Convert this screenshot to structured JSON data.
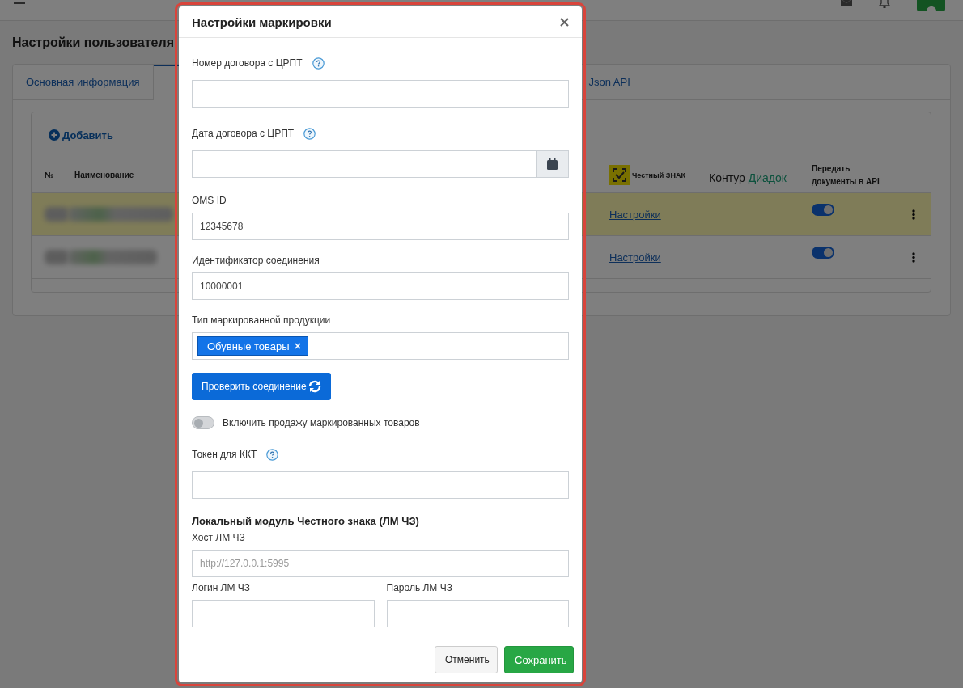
{
  "page": {
    "title": "Настройки пользователя"
  },
  "tabs": [
    {
      "label": "Основная информация",
      "selected": false
    },
    {
      "selected": true
    },
    {
      "label": "Json API",
      "selected": false
    }
  ],
  "card": {
    "add_button": "Добавить"
  },
  "table": {
    "columns": [
      {
        "kind": "text",
        "label": "№"
      },
      {
        "kind": "text",
        "label": "Наименование"
      },
      {
        "kind": "chestny",
        "label": "Честный ЗНАК"
      },
      {
        "kind": "diadok",
        "label": "Контур",
        "accent": "Диадок"
      },
      {
        "kind": "text",
        "label": "Передать документы в API"
      }
    ],
    "rows": [
      {
        "highlighted": true,
        "link": "Настройки",
        "api_on": true
      },
      {
        "highlighted": false,
        "link": "Настройки",
        "api_on": true
      }
    ]
  },
  "modal": {
    "title": "Настройки маркировки",
    "fields": [
      {
        "kind": "text",
        "label": "Номер договора с ЦРПТ",
        "help": true
      },
      {
        "kind": "date",
        "label": "Дата договора с ЦРПТ",
        "help": true
      },
      {
        "kind": "text",
        "label": "OMS ID",
        "value": "12345678"
      },
      {
        "kind": "text",
        "label": "Идентификатор соединения",
        "value": "10000001"
      },
      {
        "kind": "tags",
        "label": "Тип маркированной продукции",
        "tags": [
          "Обувные товары"
        ]
      },
      {
        "kind": "button",
        "label": "Проверить соединение"
      },
      {
        "kind": "toggle",
        "label": "Включить продажу маркированных товаров",
        "on": false
      },
      {
        "kind": "text",
        "label": "Токен для ККТ",
        "help": true
      },
      {
        "kind": "heading",
        "label": "Локальный модуль Честного знака (ЛМ ЧЗ)"
      },
      {
        "kind": "text",
        "label": "Хост ЛМ ЧЗ",
        "placeholder": "http://127.0.0.1:5995"
      },
      {
        "kind": "pair",
        "items": [
          {
            "label": "Логин ЛМ ЧЗ"
          },
          {
            "label": "Пароль ЛМ ЧЗ"
          }
        ]
      }
    ],
    "buttons": [
      {
        "kind": "secondary",
        "label": "Отменить"
      },
      {
        "kind": "primary",
        "label": "Сохранить"
      }
    ]
  }
}
